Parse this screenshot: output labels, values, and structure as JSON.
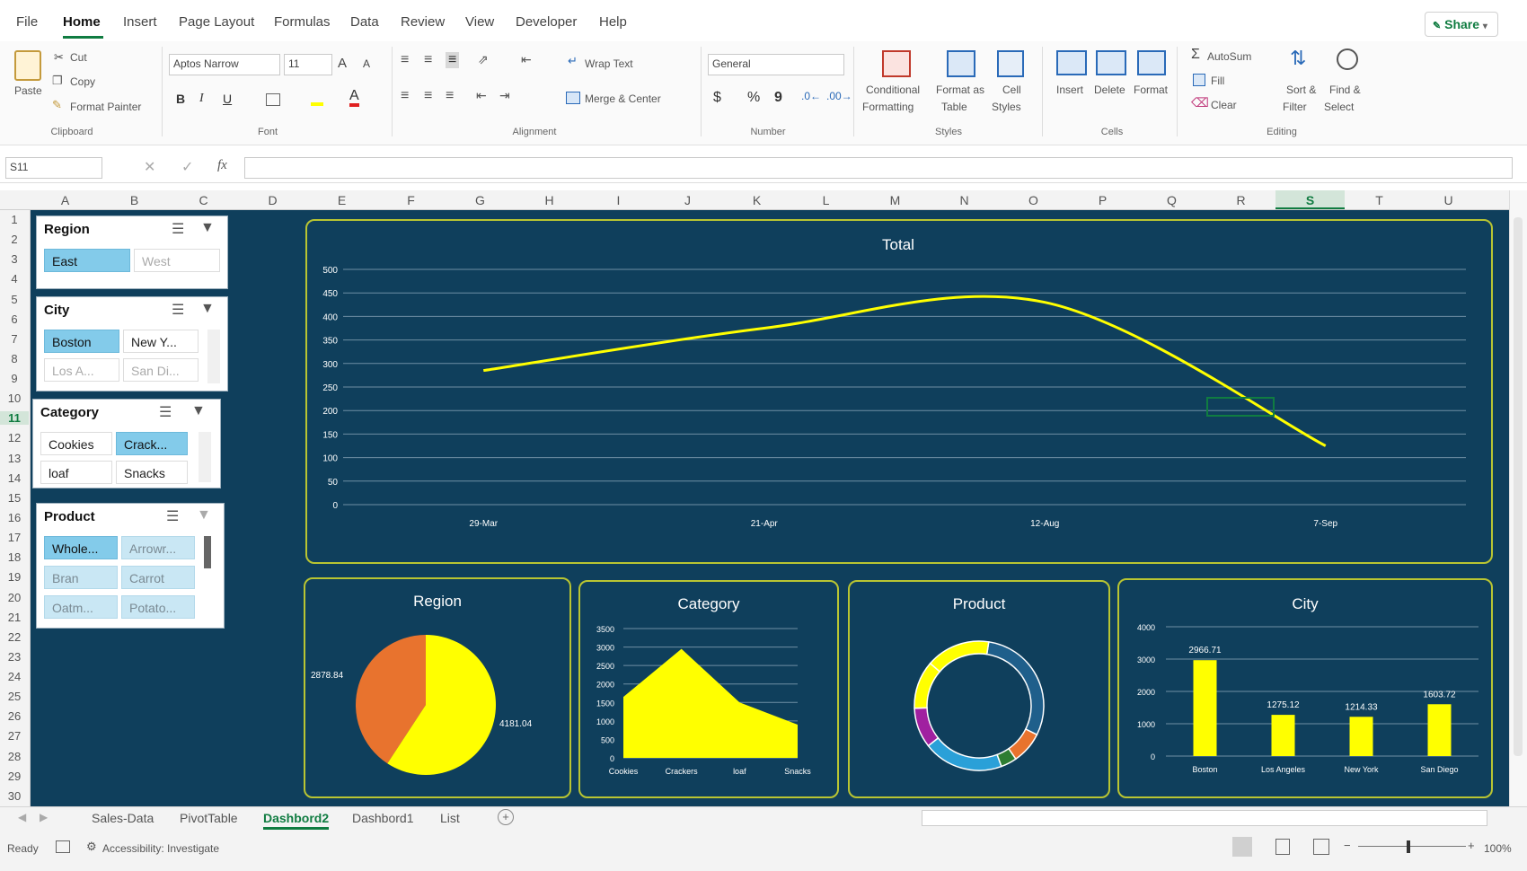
{
  "menu": {
    "tabs": [
      "File",
      "Home",
      "Insert",
      "Page Layout",
      "Formulas",
      "Data",
      "Review",
      "View",
      "Developer",
      "Help"
    ],
    "active": "Home",
    "share": "Share"
  },
  "ribbon": {
    "clipboard": {
      "paste": "Paste",
      "cut": "Cut",
      "copy": "Copy",
      "format_painter": "Format Painter",
      "group": "Clipboard"
    },
    "font": {
      "name": "Aptos Narrow",
      "size": "11",
      "group": "Font",
      "bold": "B",
      "italic": "I",
      "underline": "U",
      "grow": "A",
      "shrink": "A"
    },
    "alignment": {
      "wrap": "Wrap Text",
      "merge": "Merge & Center",
      "group": "Alignment"
    },
    "number": {
      "format": "General",
      "currency": "$",
      "percent": "%",
      "comma": "9",
      "group": "Number"
    },
    "styles": {
      "conditional": "Conditional",
      "conditional2": "Formatting",
      "format_table": "Format as",
      "format_table2": "Table",
      "cell_styles": "Cell",
      "cell_styles2": "Styles",
      "group": "Styles"
    },
    "cells": {
      "insert": "Insert",
      "delete": "Delete",
      "format": "Format",
      "group": "Cells"
    },
    "editing": {
      "autosum": "AutoSum",
      "fill": "Fill",
      "clear": "Clear",
      "sort": "Sort &",
      "sort2": "Filter",
      "find": "Find &",
      "find2": "Select",
      "group": "Editing"
    }
  },
  "formula_bar": {
    "name_box": "S11",
    "fx": "fx",
    "value": ""
  },
  "columns": [
    "A",
    "B",
    "C",
    "D",
    "E",
    "F",
    "G",
    "H",
    "I",
    "J",
    "K",
    "L",
    "M",
    "N",
    "O",
    "P",
    "Q",
    "R",
    "S",
    "T",
    "U"
  ],
  "selected_column": "S",
  "rows": [
    "1",
    "2",
    "3",
    "4",
    "5",
    "6",
    "7",
    "8",
    "9",
    "10",
    "11",
    "12",
    "13",
    "14",
    "15",
    "16",
    "17",
    "18",
    "19",
    "20",
    "21",
    "22",
    "23",
    "24",
    "25",
    "26",
    "27",
    "28",
    "29",
    "30"
  ],
  "selected_row": "11",
  "slicers": {
    "region": {
      "title": "Region",
      "items": [
        "East",
        "West"
      ]
    },
    "city": {
      "title": "City",
      "items": [
        "Boston",
        "New Y...",
        "Los A...",
        "San Di..."
      ]
    },
    "category": {
      "title": "Category",
      "items": [
        "Cookies",
        "Crack...",
        "loaf",
        "Snacks"
      ]
    },
    "product": {
      "title": "Product",
      "items": [
        "Whole...",
        "Arrowr...",
        "Bran",
        "Carrot",
        "Oatm...",
        "Potato..."
      ]
    }
  },
  "colors": {
    "sheet_bg": "#0f3f5c",
    "accent": "#ffff00",
    "border": "#b9c532",
    "orange": "#e8732e",
    "green": "#107c41"
  },
  "chart_data": [
    {
      "type": "line",
      "title": "Total",
      "x": [
        "29-Mar",
        "21-Apr",
        "12-Aug",
        "7-Sep"
      ],
      "series": [
        {
          "values": [
            285,
            375,
            430,
            125
          ]
        }
      ],
      "ylim": [
        0,
        500
      ],
      "yticks": [
        0,
        50,
        100,
        150,
        200,
        250,
        300,
        350,
        400,
        450,
        500
      ],
      "grid": true
    },
    {
      "type": "pie",
      "title": "Region",
      "values": [
        2878.84,
        4181.04
      ],
      "labels": [
        "2878.84",
        "4181.04"
      ],
      "colors": [
        "#e8732e",
        "#ffff00"
      ]
    },
    {
      "type": "area",
      "title": "Category",
      "categories": [
        "Cookies",
        "Crackers",
        "loaf",
        "Snacks"
      ],
      "values": [
        1650,
        2950,
        1500,
        900
      ],
      "ylim": [
        0,
        3500
      ],
      "yticks": [
        0,
        500,
        1000,
        1500,
        2000,
        2500,
        3000,
        3500
      ]
    },
    {
      "type": "pie",
      "title": "Product",
      "donut": true,
      "values": [
        30,
        8,
        4,
        20,
        10,
        12,
        16
      ],
      "colors": [
        "#1f5f8b",
        "#e8732e",
        "#2e7d32",
        "#2aa0d8",
        "#a020a0",
        "#ffff00",
        "#ffff00"
      ]
    },
    {
      "type": "bar",
      "title": "City",
      "categories": [
        "Boston",
        "Los Angeles",
        "New York",
        "San Diego"
      ],
      "values": [
        2966.71,
        1275.12,
        1214.33,
        1603.72
      ],
      "labels": [
        "2966.71",
        "1275.12",
        "1214.33",
        "1603.72"
      ],
      "ylim": [
        0,
        4000
      ],
      "yticks": [
        0,
        1000,
        2000,
        3000,
        4000
      ]
    }
  ],
  "sheet_tabs": [
    "Sales-Data",
    "PivotTable",
    "Dashbord2",
    "Dashbord1",
    "List"
  ],
  "active_sheet": "Dashbord2",
  "status": {
    "ready": "Ready",
    "accessibility": "Accessibility: Investigate",
    "zoom": "100%"
  }
}
